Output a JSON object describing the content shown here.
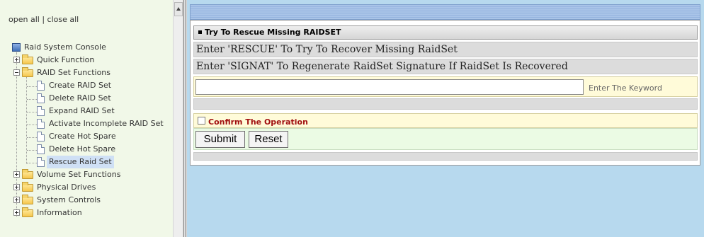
{
  "nav": {
    "open_all": "open all",
    "separator": "|",
    "close_all": "close all",
    "tree": {
      "root": "Raid System Console",
      "items": [
        {
          "label": "Quick Function",
          "expanded": false
        },
        {
          "label": "RAID Set Functions",
          "expanded": true,
          "children": [
            "Create RAID Set",
            "Delete RAID Set",
            "Expand RAID Set",
            "Activate Incomplete RAID Set",
            "Create Hot Spare",
            "Delete Hot Spare",
            "Rescue Raid Set"
          ],
          "selected_child": "Rescue Raid Set"
        },
        {
          "label": "Volume Set Functions",
          "expanded": false
        },
        {
          "label": "Physical Drives",
          "expanded": false
        },
        {
          "label": "System Controls",
          "expanded": false
        },
        {
          "label": "Information",
          "expanded": false
        }
      ]
    }
  },
  "panel": {
    "title": "Try To Rescue Missing RAIDSET",
    "line1": "Enter 'RESCUE' To Try To Recover Missing RaidSet",
    "line2": "Enter 'SIGNAT' To Regenerate RaidSet Signature If RaidSet Is Recovered",
    "keyword_value": "",
    "keyword_hint": "Enter The Keyword",
    "confirm_label": "Confirm The Operation",
    "confirm_checked": false,
    "submit_label": "Submit",
    "reset_label": "Reset"
  },
  "colors": {
    "nav_background": "#f1f8e8",
    "content_background": "#b7d9ee",
    "confirm_text": "#a11010",
    "input_row_background": "#fffbd9",
    "button_row_background": "#ebfbe4"
  }
}
